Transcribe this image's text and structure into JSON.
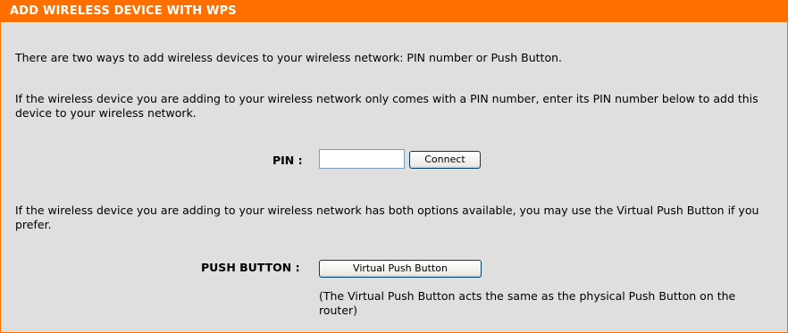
{
  "header": {
    "title": "ADD WIRELESS DEVICE WITH WPS"
  },
  "intro": {
    "text": "There are two ways to add wireless devices to your wireless network: PIN number or Push Button."
  },
  "pin_section": {
    "description": "If the wireless device you are adding to your wireless network only comes with a PIN number, enter its PIN number below to add this device to your wireless network.",
    "label": "PIN :",
    "input_value": "",
    "connect_label": "Connect"
  },
  "push_section": {
    "description": "If the wireless device you are adding to your wireless network has both options available, you may use the Virtual Push Button if you prefer.",
    "label": "PUSH BUTTON :",
    "button_label": "Virtual Push Button",
    "note": "(The Virtual Push Button acts the same as the physical Push Button on the router)"
  },
  "colors": {
    "header_bg": "#ff6f00",
    "panel_bg": "#dfdfdf",
    "header_text": "#ffffff"
  }
}
